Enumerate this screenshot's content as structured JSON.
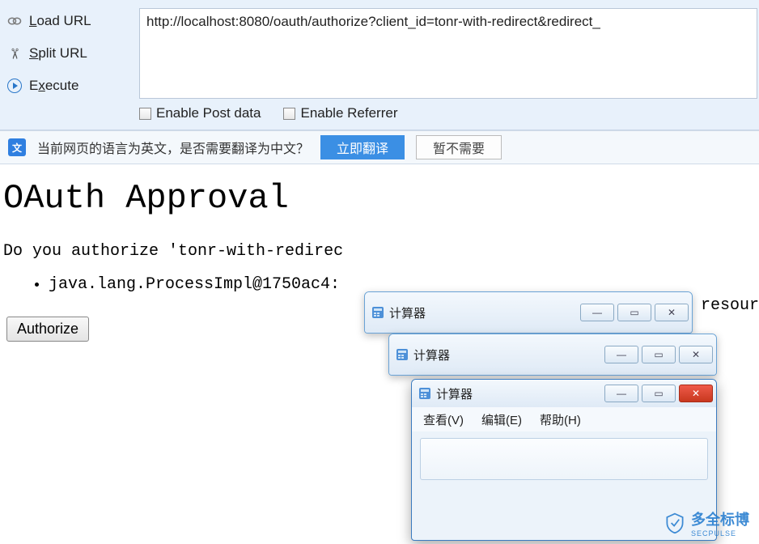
{
  "toolbar": {
    "load_label": "Load URL",
    "split_label": "Split URL",
    "execute_label": "Execute",
    "url_value": "http://localhost:8080/oauth/authorize?client_id=tonr-with-redirect&redirect_",
    "enable_post_label": "Enable Post data",
    "enable_referrer_label": "Enable Referrer"
  },
  "translate": {
    "prompt": "当前网页的语言为英文，是否需要翻译为中文？",
    "translate_btn": "立即翻译",
    "dismiss_btn": "暂不需要"
  },
  "page": {
    "heading": "OAuth Approval",
    "question_prefix": "Do you authorize 'tonr-with-redirec",
    "question_suffix": "resour",
    "list_item": "java.lang.ProcessImpl@1750ac4:",
    "authorize_btn": "Authorize"
  },
  "calc": {
    "title": "计算器",
    "menu_view": "查看(V)",
    "menu_edit": "编辑(E)",
    "menu_help": "帮助(H)"
  },
  "watermark": {
    "brand": "多全标博",
    "sub": "SECPULSE"
  }
}
